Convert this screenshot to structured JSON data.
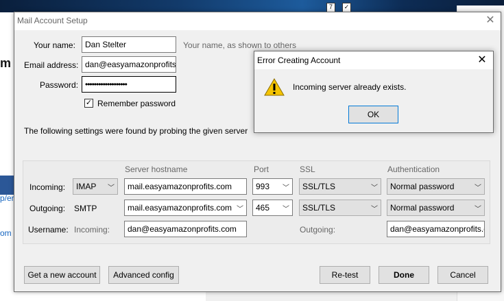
{
  "background": {
    "partial_heading": "m",
    "partial_link1": "p/er",
    "partial_link2": "om"
  },
  "dialog": {
    "title": "Mail Account Setup",
    "your_name_label": "Your name:",
    "your_name_value": "Dan Stelter",
    "your_name_hint": "Your name, as shown to others",
    "email_label": "Email address:",
    "email_value": "dan@easyamazonprofits",
    "password_label": "Password:",
    "password_value": "•••••••••••••••••••",
    "remember_label": "Remember password",
    "remember_checked": true,
    "probe_text": "The following settings were found by probing the given server",
    "columns": {
      "hostname": "Server hostname",
      "port": "Port",
      "ssl": "SSL",
      "auth": "Authentication"
    },
    "incoming": {
      "label": "Incoming:",
      "protocol": "IMAP",
      "hostname": "mail.easyamazonprofits.com",
      "port": "993",
      "ssl": "SSL/TLS",
      "auth": "Normal password"
    },
    "outgoing": {
      "label": "Outgoing:",
      "protocol": "SMTP",
      "hostname": "mail.easyamazonprofits.com",
      "port": "465",
      "ssl": "SSL/TLS",
      "auth": "Normal password"
    },
    "username": {
      "label": "Username:",
      "incoming_label": "Incoming:",
      "incoming_value": "dan@easyamazonprofits.com",
      "outgoing_label": "Outgoing:",
      "outgoing_value": "dan@easyamazonprofits.c"
    },
    "buttons": {
      "new_account": "Get a new account",
      "advanced": "Advanced config",
      "retest": "Re-test",
      "done": "Done",
      "cancel": "Cancel"
    }
  },
  "error_dialog": {
    "title": "Error Creating Account",
    "message": "Incoming server already exists.",
    "ok": "OK"
  }
}
